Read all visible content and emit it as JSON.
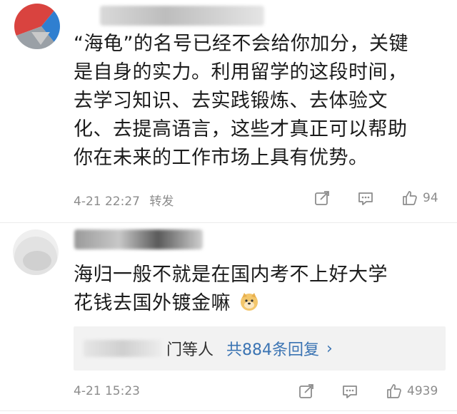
{
  "comments": [
    {
      "text_lines": [
        "“海龟”的名号已经不会给你加分，关键",
        "是自身的实力。利用留学的这段时间，",
        "去学习知识、去实践锻炼、去体验文",
        "化、去提高语言，这些才真正可以帮助",
        "你在未来的工作市场上具有优势。"
      ],
      "timestamp": "4-21 22:27",
      "repost_label": "转发",
      "like_count": "94",
      "icons": {
        "share": "share-icon",
        "comment": "comment-icon",
        "like": "thumbs-up-icon"
      }
    },
    {
      "text_lines": [
        "海归一般不就是在国内考不上好大学",
        "花钱去国外镀金嘛"
      ],
      "emoji": "doge-emoji",
      "reply_summary": {
        "others_label": "门等人",
        "link_label": "共884条回复",
        "chevron": "›"
      },
      "timestamp": "4-21 15:23",
      "like_count": "4939",
      "icons": {
        "share": "share-icon",
        "comment": "comment-icon",
        "like": "thumbs-up-icon"
      }
    }
  ],
  "colors": {
    "link": "#3b74b3",
    "meta": "#8c8c8c",
    "reply_bg": "#f2f2f2",
    "avatar1_red": "#d9433f",
    "avatar1_blue": "#2f7fd0"
  }
}
